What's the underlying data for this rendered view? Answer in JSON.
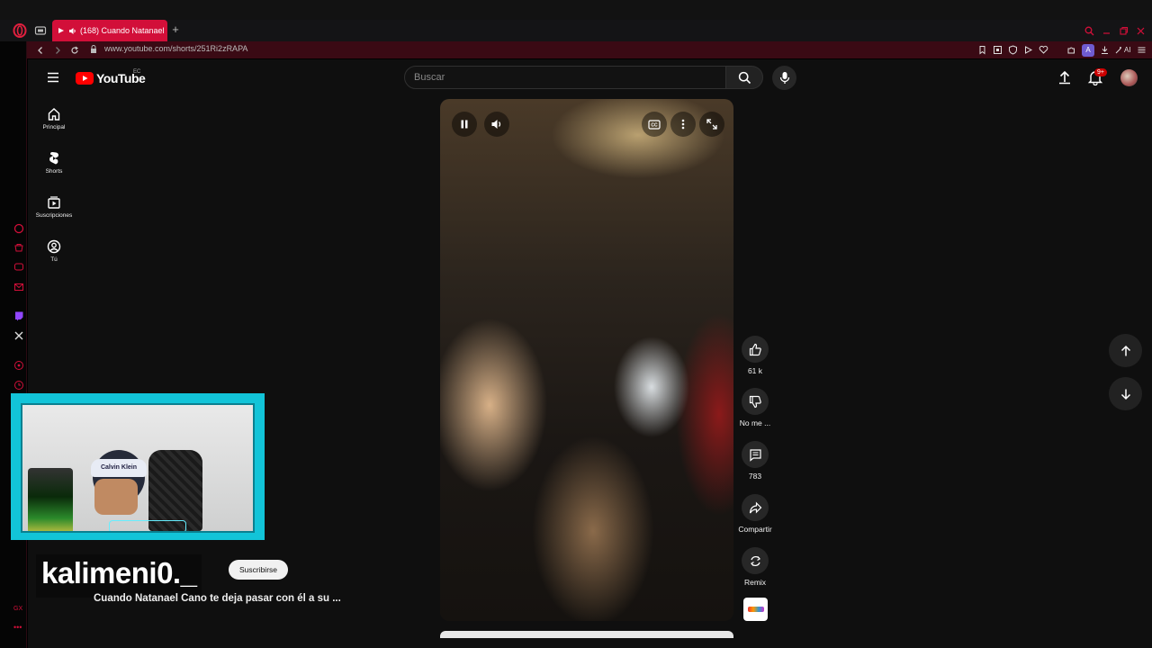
{
  "browser": {
    "tab_title": "(168) Cuando Natanael",
    "url": "www.youtube.com/shorts/251Ri2zRAPA",
    "ai_label": "AI",
    "account_initial": "A"
  },
  "youtube": {
    "logo_text": "YouTube",
    "country_code": "EC",
    "search_placeholder": "Buscar",
    "notifications_badge": "9+",
    "sidebar": [
      {
        "label": "Principal",
        "icon": "home-icon"
      },
      {
        "label": "Shorts",
        "icon": "shorts-icon"
      },
      {
        "label": "Suscripciones",
        "icon": "subscriptions-icon"
      },
      {
        "label": "Tú",
        "icon": "you-icon"
      }
    ],
    "actions": {
      "like_count": "61 k",
      "dislike_label": "No me ...",
      "comments_count": "783",
      "share_label": "Compartir",
      "remix_label": "Remix"
    },
    "video_title": "Cuando Natanael Cano te deja pasar con él a su ...",
    "subscribe_label": "Suscribirse"
  },
  "overlay": {
    "streamer_name": "kalimeni0._",
    "cap_text": "Calvin Klein"
  },
  "colors": {
    "browser_accent": "#d20f39",
    "address_bar": "#3a0a14",
    "youtube_bg": "#0f0f0f",
    "webcam_frame": "#12c4d8"
  }
}
